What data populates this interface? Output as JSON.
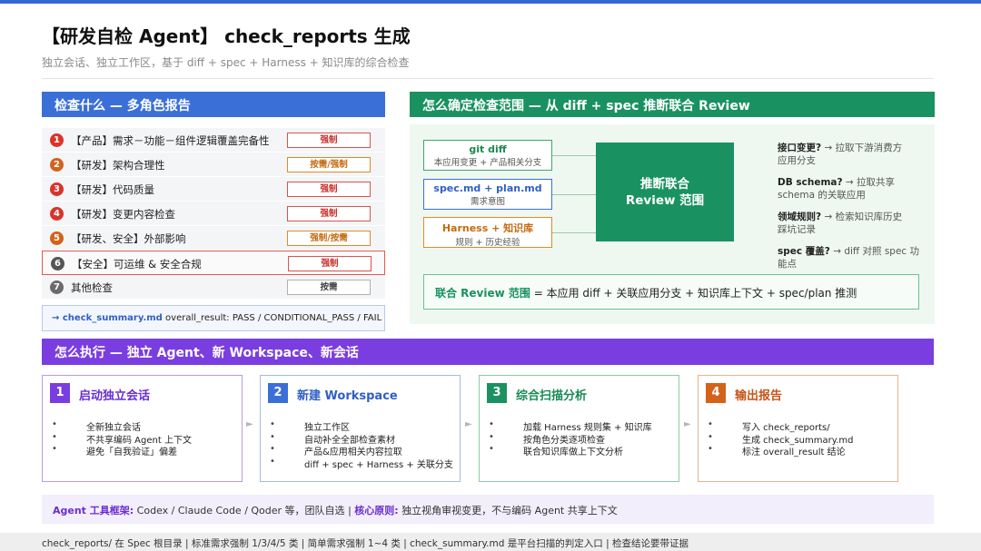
{
  "header": {
    "title": "【研发自检 Agent】 check_reports 生成",
    "subtitle": "独立会话、独立工作区，基于 diff + spec + Harness + 知识库的综合检查"
  },
  "left": {
    "heading": "检查什么 — 多角色报告",
    "items": [
      {
        "num": "1",
        "label": "【产品】需求－功能－组件逻辑覆盖完备性",
        "tag": "强制",
        "num_color": "#d9342b"
      },
      {
        "num": "2",
        "label": "【研发】架构合理性",
        "tag": "按需/强制",
        "num_color": "#d4621a"
      },
      {
        "num": "3",
        "label": "【研发】代码质量",
        "tag": "强制",
        "num_color": "#d9342b"
      },
      {
        "num": "4",
        "label": "【研发】变更内容检查",
        "tag": "强制",
        "num_color": "#d9342b"
      },
      {
        "num": "5",
        "label": "【研发、安全】外部影响",
        "tag": "强制/按需",
        "num_color": "#d4621a"
      },
      {
        "num": "6",
        "label": "【安全】可运维 & 安全合规",
        "tag": "强制",
        "num_color": "#555555"
      },
      {
        "num": "7",
        "label": "其他检查",
        "tag": "按需",
        "num_color": "#6b6b6b"
      }
    ],
    "summary_key": "→ check_summary.md",
    "summary_text": "overall_result: PASS / CONDITIONAL_PASS / FAIL"
  },
  "right": {
    "heading": "怎么确定检查范围 — 从 diff + spec 推断联合 Review",
    "sources": [
      {
        "title": "git diff",
        "sub": "本应用变更 + 产品相关分支"
      },
      {
        "title": "spec.md + plan.md",
        "sub": "需求意图"
      },
      {
        "title": "Harness + 知识库",
        "sub": "规则 + 历史经验"
      }
    ],
    "center_line1": "推断联合",
    "center_line2": "Review 范围",
    "questions": [
      {
        "q": "接口变更?",
        "a1": "→ 拉取下游消费方",
        "a2": "应用分支"
      },
      {
        "q": "DB schema?",
        "a1": "→ 拉取共享",
        "a2": "schema 的关联应用"
      },
      {
        "q": "领域规则?",
        "a1": "→ 检索知识库历史",
        "a2": "踩坑记录"
      },
      {
        "q": "spec 覆盖?",
        "a1": "→ diff 对照 spec 功",
        "a2": "能点"
      }
    ],
    "scope_key": "联合 Review 范围",
    "scope_text": "= 本应用 diff + 关联应用分支 + 知识库上下文 + spec/plan 推测"
  },
  "execution": {
    "heading": "怎么执行 — 独立 Agent、新 Workspace、新会话",
    "steps": [
      {
        "num": "1",
        "title": "启动独立会话",
        "bullets": [
          "全新独立会话",
          "不共享编码 Agent 上下文",
          "避免「自我验证」偏差"
        ]
      },
      {
        "num": "2",
        "title": "新建 Workspace",
        "bullets": [
          "独立工作区",
          "自动补全全部检查素材",
          "产品&应用相关内容拉取",
          "diff + spec + Harness + 关联分支"
        ]
      },
      {
        "num": "3",
        "title": "综合扫描分析",
        "bullets": [
          "加载 Harness 规则集 + 知识库",
          "按角色分类逐项检查",
          "联合知识库做上下文分析"
        ]
      },
      {
        "num": "4",
        "title": "输出报告",
        "bullets": [
          "写入 check_reports/",
          "生成 check_summary.md",
          "标注 overall_result 结论"
        ]
      }
    ],
    "arrow": "►"
  },
  "toolbar": {
    "framework_key": "Agent 工具框架:",
    "framework_text": "Codex / Claude Code / Qoder 等，团队自选",
    "separator": "|",
    "principle_key": "核心原则:",
    "principle_text": "独立视角审视变更，不与编码 Agent 共享上下文"
  },
  "footer": {
    "text": "check_reports/ 在 Spec 根目录 | 标准需求强制 1/3/4/5 类 | 简单需求强制 1~4 类 | check_summary.md 是平台扫描的判定入口 | 检查结论要带证据"
  }
}
